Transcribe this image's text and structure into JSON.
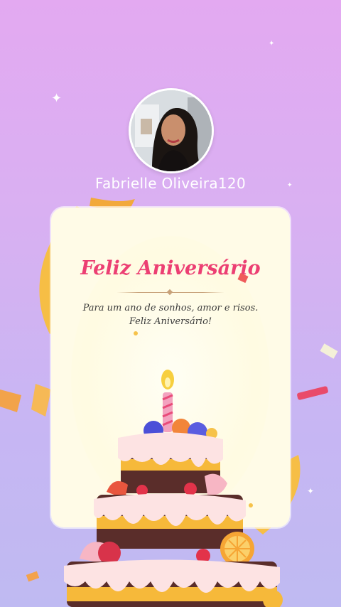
{
  "profile": {
    "username": "Fabrielle Oliveira120",
    "avatar_icon": "profile-photo"
  },
  "card": {
    "title": "Feliz Aniversário",
    "message_line1": "Para um ano de sonhos, amor e risos.",
    "message_line2": "Feliz Aniversário!"
  },
  "colors": {
    "background_top": "#e3a9f1",
    "background_bottom": "#bfbaf2",
    "card_background": "#fffbe7",
    "title": "#ec3f73",
    "ribbon": "#f7c24a"
  }
}
